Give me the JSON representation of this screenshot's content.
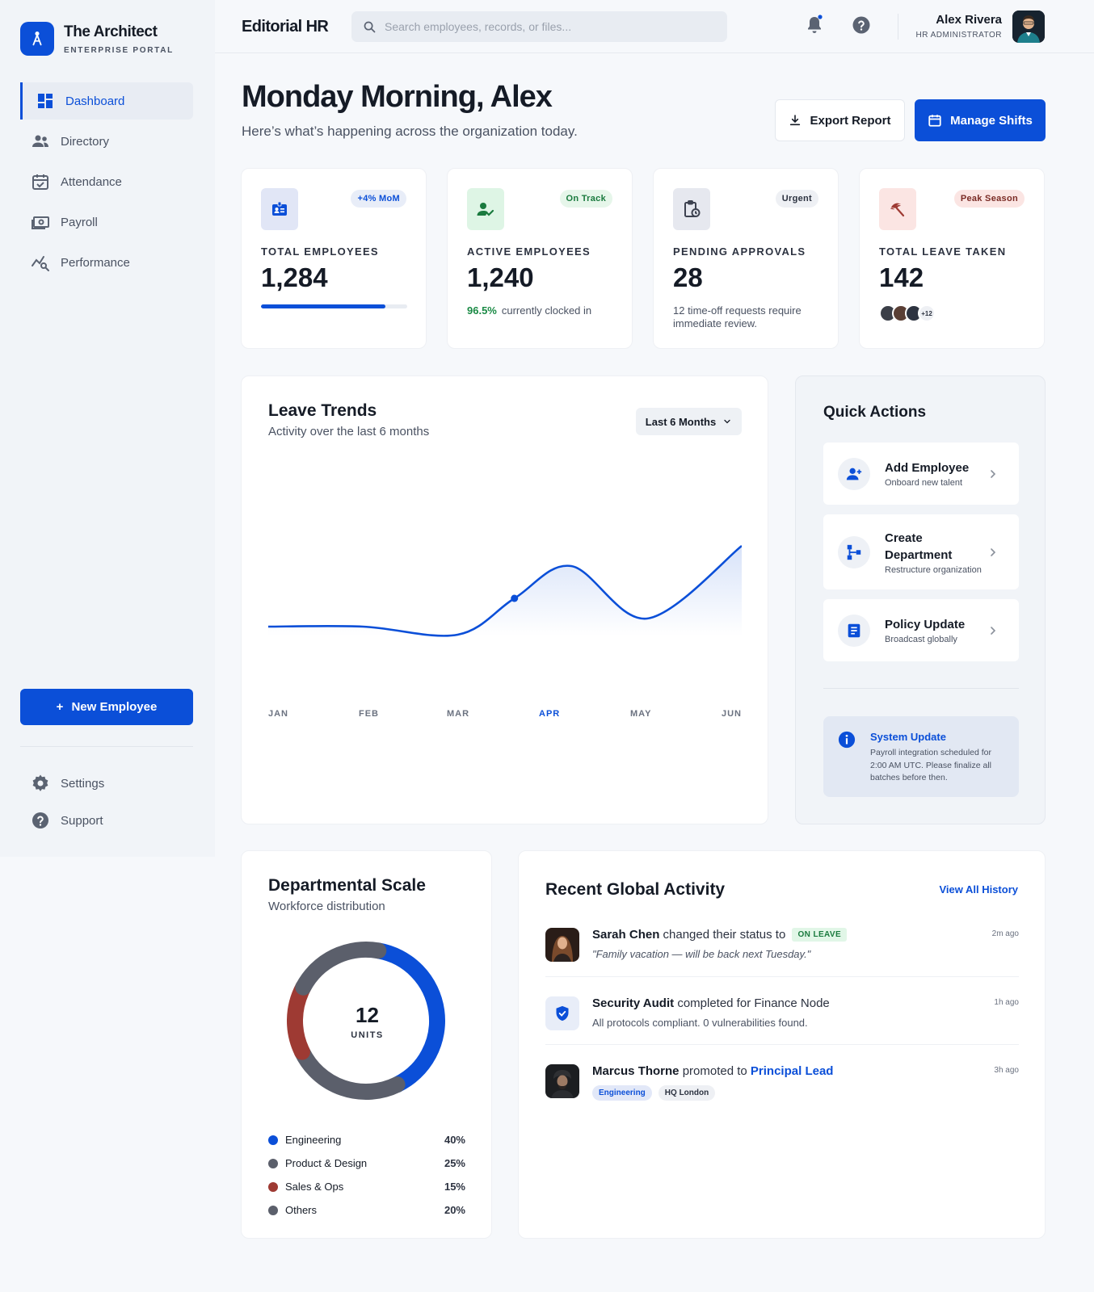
{
  "brand": {
    "title": "The Architect",
    "subtitle": "ENTERPRISE PORTAL"
  },
  "sidebar": {
    "items": [
      {
        "label": "Dashboard",
        "icon": "dashboard-icon"
      },
      {
        "label": "Directory",
        "icon": "users-icon"
      },
      {
        "label": "Attendance",
        "icon": "calendar-check-icon"
      },
      {
        "label": "Payroll",
        "icon": "cash-icon"
      },
      {
        "label": "Performance",
        "icon": "analytics-icon"
      }
    ],
    "active": "Dashboard",
    "new_employee_label": "New Employee",
    "bottom": [
      {
        "label": "Settings",
        "icon": "gear-icon"
      },
      {
        "label": "Support",
        "icon": "help-icon"
      }
    ]
  },
  "topbar": {
    "title": "Editorial HR",
    "search_placeholder": "Search employees, records, or files...",
    "user_name": "Alex Rivera",
    "user_role": "HR ADMINISTRATOR"
  },
  "header": {
    "greeting": "Monday Morning, Alex",
    "subtitle": "Here’s what’s happening across the organization today.",
    "export_label": "Export Report",
    "shifts_label": "Manage Shifts"
  },
  "stats": [
    {
      "label": "TOTAL EMPLOYEES",
      "value": "1,284",
      "badge": "+4% MoM",
      "progress": 0.85
    },
    {
      "label": "ACTIVE EMPLOYEES",
      "value": "1,240",
      "badge": "On Track",
      "note_pct": "96.5%",
      "note": "currently clocked in"
    },
    {
      "label": "PENDING APPROVALS",
      "value": "28",
      "badge": "Urgent",
      "note": "12 time-off requests require immediate review."
    },
    {
      "label": "TOTAL LEAVE TAKEN",
      "value": "142",
      "badge": "Peak Season",
      "more": "+12"
    }
  ],
  "trends": {
    "title": "Leave Trends",
    "subtitle": "Activity over the last 6 months",
    "range": "Last 6 Months",
    "months": [
      "JAN",
      "FEB",
      "MAR",
      "APR",
      "MAY",
      "JUN"
    ],
    "active_month": "APR"
  },
  "chart_data": {
    "type": "line",
    "categories": [
      "JAN",
      "FEB",
      "MAR",
      "APR",
      "MAY",
      "JUN"
    ],
    "values": [
      28,
      28,
      24,
      42,
      58,
      32,
      68
    ],
    "x": [
      0,
      1,
      2,
      2.6,
      3.2,
      4.0,
      5.0
    ],
    "highlight_x": 2.6,
    "ylim": [
      0,
      100
    ],
    "grid": false,
    "line_color": "#0b4fd8"
  },
  "quick_actions": {
    "title": "Quick Actions",
    "items": [
      {
        "name": "Add Employee",
        "desc": "Onboard new talent"
      },
      {
        "name": "Create Department",
        "desc": "Restructure organization"
      },
      {
        "name": "Policy Update",
        "desc": "Broadcast globally"
      }
    ],
    "system": {
      "title": "System Update",
      "text": "Payroll integration scheduled for 2:00 AM UTC. Please finalize all batches before then."
    }
  },
  "departments": {
    "title": "Departmental Scale",
    "subtitle": "Workforce distribution",
    "center_value": "12",
    "center_unit": "UNITS",
    "segments": [
      {
        "name": "Engineering",
        "pct": "40%",
        "value": 40,
        "color": "#0b4fd8"
      },
      {
        "name": "Product & Design",
        "pct": "25%",
        "value": 25,
        "color": "#5b5f6b"
      },
      {
        "name": "Sales & Ops",
        "pct": "15%",
        "value": 15,
        "color": "#9e3a33"
      },
      {
        "name": "Others",
        "pct": "20%",
        "value": 20,
        "color": "#5b5f6b"
      }
    ]
  },
  "activity": {
    "title": "Recent Global Activity",
    "view_all": "View All History",
    "items": [
      {
        "who": "Sarah Chen",
        "action": "changed their status to",
        "pill": "ON LEAVE",
        "sub": "\"Family vacation — will be back next Tuesday.\"",
        "time": "2m ago"
      },
      {
        "who": "Security Audit",
        "action": "completed for Finance Node",
        "sub": "All protocols compliant. 0 vulnerabilities found.",
        "time": "1h ago"
      },
      {
        "who": "Marcus Thorne",
        "action": "promoted to",
        "target": "Principal Lead",
        "tags": [
          "Engineering",
          "HQ London"
        ],
        "time": "3h ago"
      }
    ]
  },
  "colors": {
    "accent": "#0b4fd8",
    "success": "#1a8a45",
    "danger": "#9e3a33"
  }
}
